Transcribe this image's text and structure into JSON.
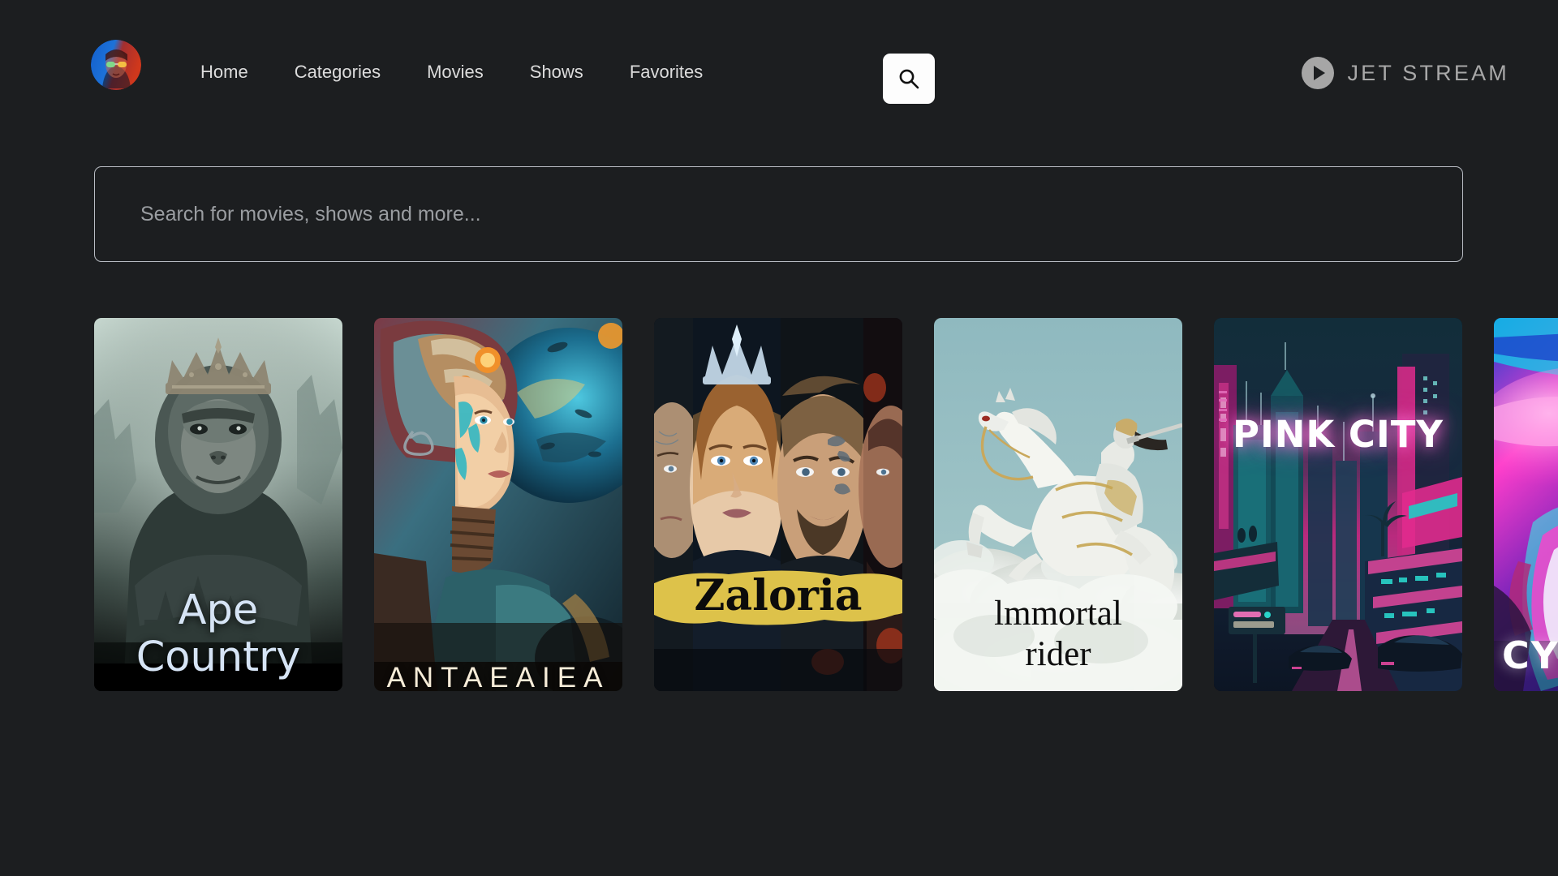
{
  "app": {
    "background_color": "#1c1e20",
    "brand_name": "JET STREAM",
    "brand_color": "#a8a8a8"
  },
  "header": {
    "logo": {
      "icon": "avatar-logo",
      "alt": "profile avatar logo"
    },
    "nav_items": [
      {
        "label": "Home"
      },
      {
        "label": "Categories"
      },
      {
        "label": "Movies"
      },
      {
        "label": "Shows"
      },
      {
        "label": "Favorites"
      }
    ],
    "search_button": {
      "icon": "search-icon",
      "background": "#fdfdfd",
      "glyph_color": "#111111"
    },
    "brand": {
      "icon": "play-circle-icon",
      "text": "JET STREAM"
    }
  },
  "search": {
    "value": "",
    "placeholder": "Search for movies, shows and more...",
    "border_color": "#b9bdc4"
  },
  "carousel": {
    "cards": [
      {
        "title": "Ape Country",
        "title_lines": [
          "Ape",
          "Country"
        ],
        "title_color": "#d6e4f5",
        "poster_description": "crowned gorilla over misty ruined city",
        "palette": [
          "#b9cec7",
          "#5d7570",
          "#2b3632",
          "#000000"
        ]
      },
      {
        "title": "ANTAEAIEA",
        "title_lines": [
          "ANTAEAIEA"
        ],
        "title_color": "#f6ecd8",
        "poster_description": "sci-fi woman with ornate mechanical helmet and blue planet",
        "palette": [
          "#2f8fa6",
          "#1d5f77",
          "#8a4a3c",
          "#e8b87a"
        ]
      },
      {
        "title": "Zaloria",
        "title_lines": [
          "Zaloria"
        ],
        "title_color": "#0b0b0b",
        "banner_color": "#ddc24a",
        "poster_description": "four vertical character face panels with crowned queen",
        "palette": [
          "#1b2430",
          "#cfa978",
          "#ddc24a",
          "#0a0d12"
        ]
      },
      {
        "title": "lmmortal rider",
        "title_lines": [
          "lmmortal",
          "rider"
        ],
        "title_color": "#0d0d0d",
        "poster_description": "white horse and rider rearing above clouds in pale sky",
        "palette": [
          "#8fb7bd",
          "#eef2f3",
          "#c9cfc6",
          "#8d8b7c"
        ]
      },
      {
        "title": "PINK CITY",
        "title_lines": [
          "PINK CITY"
        ],
        "title_color": "#ffffff",
        "poster_description": "neon cyberpunk skyline with pink and teal towers",
        "palette": [
          "#14easy",
          "#ff3fa4",
          "#19d3c5",
          "#151b33"
        ]
      },
      {
        "title": "CY",
        "title_lines": [
          "CY"
        ],
        "title_color": "#ffffff",
        "poster_description": "vivid magenta and blue neon portrait, partially scrolled off screen",
        "palette": [
          "#ff3ecb",
          "#2a5cf5",
          "#00d8ff",
          "#6a21b8"
        ]
      }
    ]
  }
}
